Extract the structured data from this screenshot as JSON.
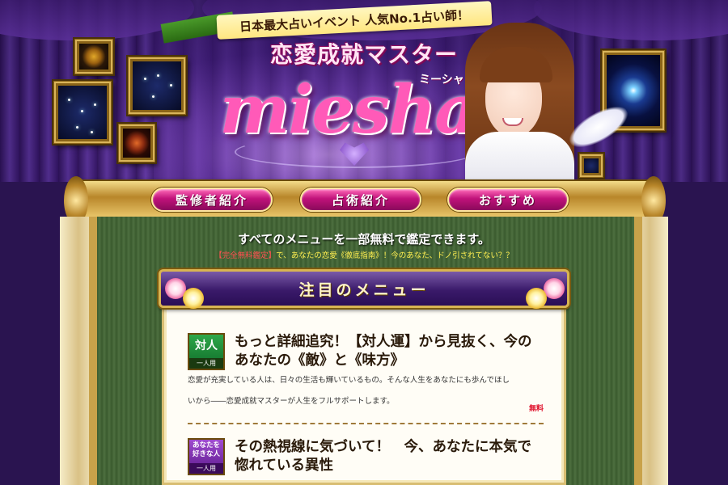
{
  "header": {
    "ribbon_text": "日本最大占いイベント 人気No.1占い師！",
    "subtitle": "恋愛成就マスター",
    "logo_text": "miesha",
    "logo_kana": "ミーシャ"
  },
  "nav": {
    "items": [
      {
        "label": "監修者紹介"
      },
      {
        "label": "占術紹介"
      },
      {
        "label": "おすすめ"
      }
    ]
  },
  "main": {
    "banner": "すべてのメニューを一部無料で鑑定できます。",
    "promo_tag": "【完全無料鑑定】",
    "promo_text": "で、あなたの恋愛《徹底指南》！今のあなた、ドノ引されてない？？",
    "section_title": "注目のメニュー",
    "items": [
      {
        "badge_main": "対人",
        "badge_sub": "一人用",
        "title": "もっと詳細追究！【対人運】から見抜く、今のあなたの《敵》と《味方》",
        "description_line1": "恋愛が充実している人は、日々の生活も輝いているもの。そんな人生をあなたにも歩んでほし",
        "description_line2": "いから――恋愛成就マスターが人生をフルサポートします。",
        "price": "無料"
      },
      {
        "badge_main": "あなたを好きな人",
        "badge_sub": "一人用",
        "title": "その熱視線に気づいて！　今、あなたに本気で惚れている異性"
      }
    ]
  },
  "colors": {
    "header_bg": "#3b1a72",
    "nav_button": "#c0127a",
    "gold": "#c9a24a",
    "panel_green": "#3a5a2e",
    "section_purple": "#3a1a6a"
  }
}
